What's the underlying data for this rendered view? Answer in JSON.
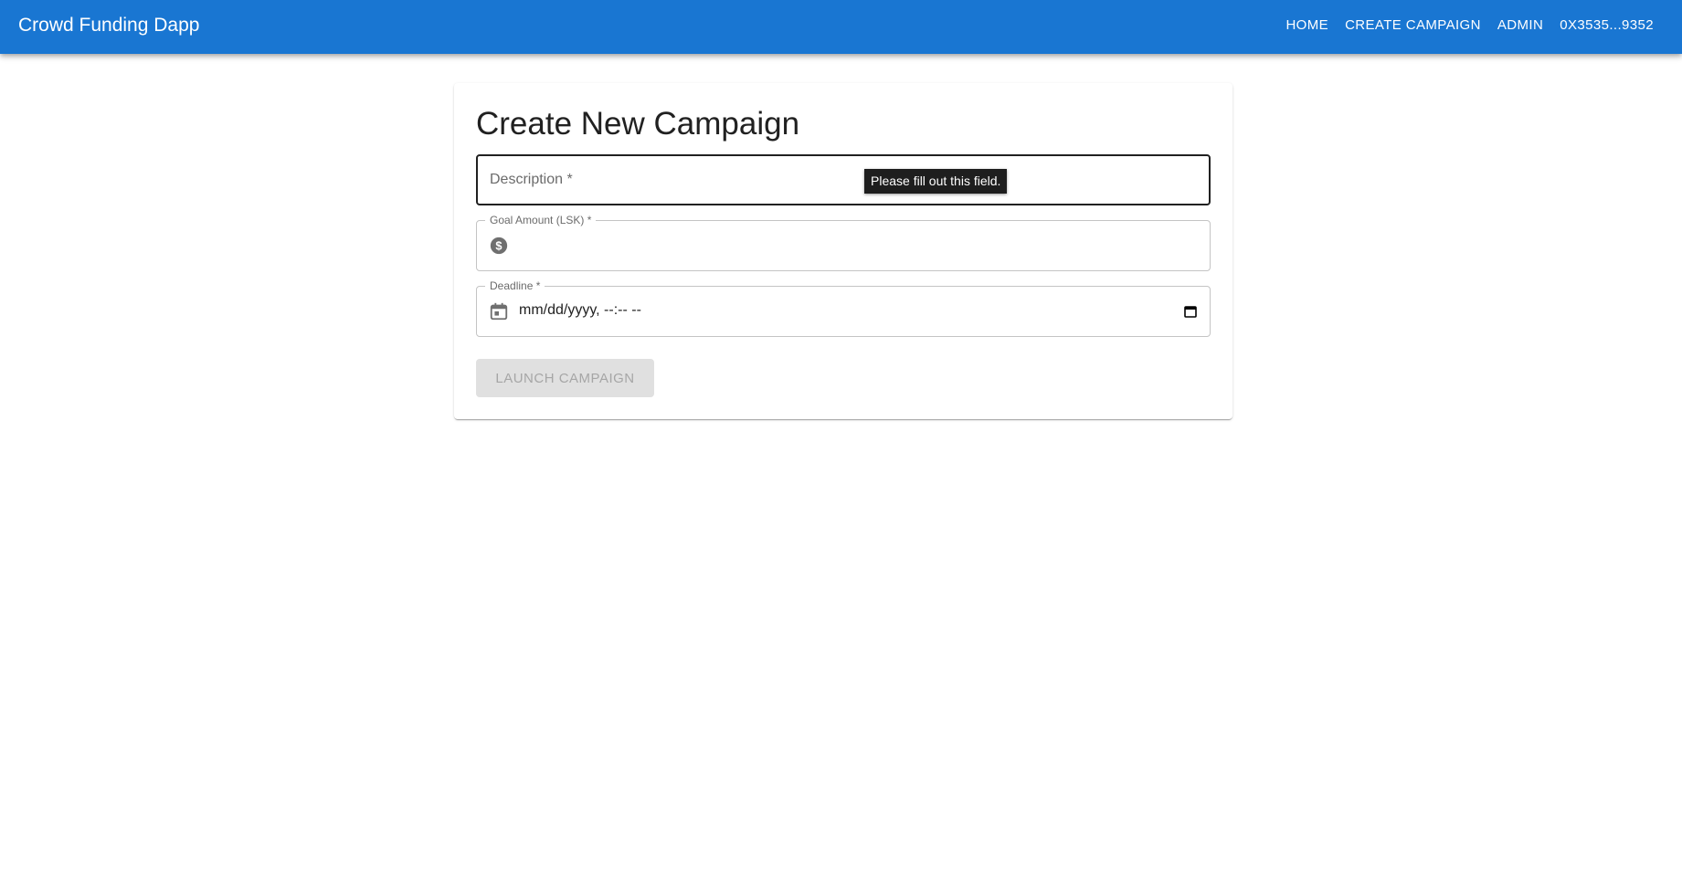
{
  "app": {
    "title": "Crowd Funding Dapp",
    "brand_color": "#1976d2"
  },
  "nav": {
    "items": [
      {
        "label": "HOME"
      },
      {
        "label": "CREATE CAMPAIGN"
      },
      {
        "label": "ADMIN"
      },
      {
        "label": "0X3535...9352"
      }
    ]
  },
  "form": {
    "title": "Create New Campaign",
    "description": {
      "label": "Description *",
      "value": ""
    },
    "goal_amount": {
      "label": "Goal Amount (LSK) *",
      "icon": "dollar-icon",
      "value": ""
    },
    "deadline": {
      "label": "Deadline *",
      "icon": "calendar-icon",
      "value": "mm/dd/yyyy, --:-- --"
    },
    "submit": {
      "label": "LAUNCH CAMPAIGN",
      "disabled": true
    }
  },
  "tooltip": {
    "text": "Please fill out this field."
  }
}
